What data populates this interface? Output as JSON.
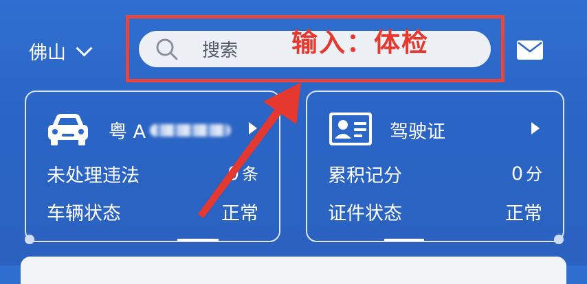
{
  "header": {
    "city": "佛山",
    "search_placeholder": "搜索",
    "annotation": "输入：体检"
  },
  "vehicle_card": {
    "plate_prefix": "粤 A",
    "rows": [
      {
        "label": "未处理违法",
        "value": "0",
        "unit": "条"
      },
      {
        "label": "车辆状态",
        "value": "正常",
        "unit": ""
      }
    ]
  },
  "license_card": {
    "title": "驾驶证",
    "rows": [
      {
        "label": "累积记分",
        "value": "0",
        "unit": "分"
      },
      {
        "label": "证件状态",
        "value": "正常",
        "unit": ""
      }
    ]
  },
  "icons": {
    "location_dropdown": "chevron-down-icon",
    "search": "search-icon",
    "mail": "mail-icon",
    "car": "car-icon",
    "license": "license-card-icon",
    "card_arrow": "chevron-right-icon"
  },
  "colors": {
    "background": "#2b67c8",
    "annotation": "#e5382f",
    "search_field": "#edf0f5"
  }
}
